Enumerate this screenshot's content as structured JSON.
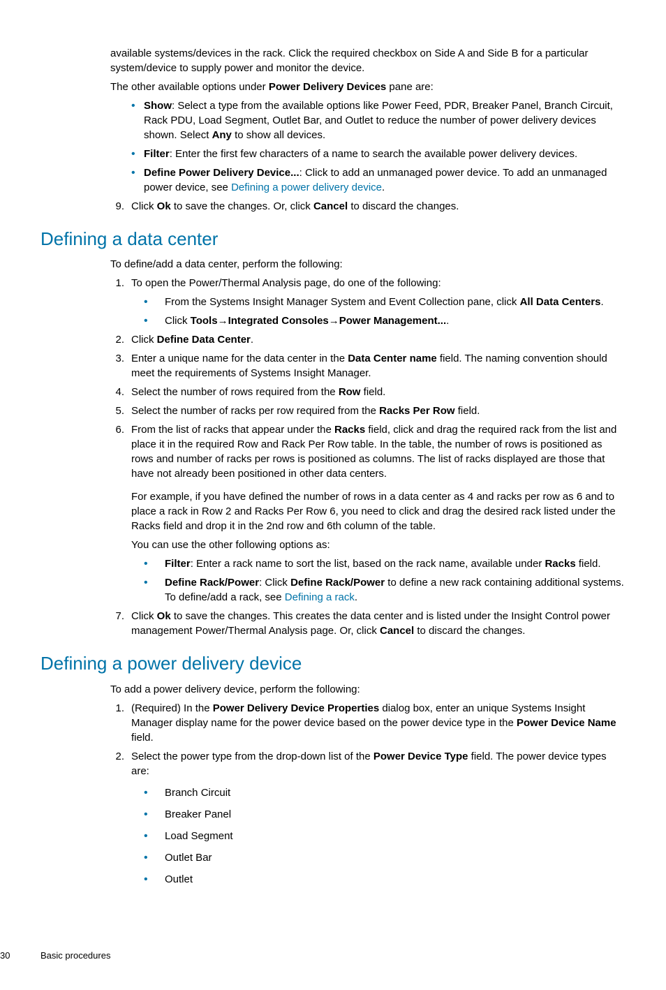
{
  "intro": {
    "p1": "available systems/devices in the rack. Click the required checkbox on Side A and Side B for a particular system/device to supply power and monitor the device.",
    "p2_pre": "The other available options under ",
    "p2_b": "Power Delivery Devices",
    "p2_post": " pane are:",
    "b1_b": "Show",
    "b1_t1": ": Select a type from the available options like Power Feed, PDR, Breaker Panel, Branch Circuit, Rack PDU, Load Segment, Outlet Bar, and Outlet to reduce the number of power delivery devices shown. Select ",
    "b1_b2": "Any",
    "b1_t2": " to show all devices.",
    "b2_b": "Filter",
    "b2_t": ": Enter the first few characters of a name to search the available power delivery devices.",
    "b3_b": "Define Power Delivery Device...",
    "b3_t1": ": Click to add an unmanaged power device. To add an unmanaged power device, see ",
    "b3_link": "Defining a power delivery device",
    "b3_t2": ".",
    "s9_n": "9.",
    "s9_t1": "Click ",
    "s9_b1": "Ok",
    "s9_t2": " to save the changes. Or, click ",
    "s9_b2": "Cancel",
    "s9_t3": " to discard the changes."
  },
  "dc": {
    "title": "Defining a data center",
    "intro": "To define/add a data center, perform the following:",
    "s1_n": "1.",
    "s1_t": "To open the Power/Thermal Analysis page, do one of the following:",
    "s1_b1_t1": "From the Systems Insight Manager System and Event Collection pane, click ",
    "s1_b1_b": "All Data Centers",
    "s1_b1_t2": ".",
    "s1_b2_t1": "Click ",
    "s1_b2_b1": "Tools",
    "s1_b2_arr": "→",
    "s1_b2_b2": "Integrated Consoles",
    "s1_b2_b3": "Power Management...",
    "s1_b2_t2": ".",
    "s2_n": "2.",
    "s2_t1": "Click ",
    "s2_b": "Define Data Center",
    "s2_t2": ".",
    "s3_n": "3.",
    "s3_t1": "Enter a unique name for the data center in the ",
    "s3_b": "Data Center name",
    "s3_t2": " field. The naming convention should meet the requirements of Systems Insight Manager.",
    "s4_n": "4.",
    "s4_t1": "Select the number of rows required from the ",
    "s4_b": "Row",
    "s4_t2": " field.",
    "s5_n": "5.",
    "s5_t1": "Select the number of racks per row required from the ",
    "s5_b": "Racks Per Row",
    "s5_t2": " field.",
    "s6_n": "6.",
    "s6_t1": "From the list of racks that appear under the ",
    "s6_b": "Racks",
    "s6_t2": " field, click and drag the required rack from the list and place it in the required Row and Rack Per Row table. In the table, the number of rows is positioned as rows and number of racks per rows is positioned as columns. The list of racks displayed are those that have not already been positioned in other data centers.",
    "s6_p2": "For example, if you have defined the number of rows in a data center as 4 and racks per row as 6 and to place a rack in Row 2 and Racks Per Row 6, you need to click and drag the desired rack listed under the Racks field and drop it in the 2nd row and 6th column of the table.",
    "s6_p3": "You can use the other following options as:",
    "s6_b1_b": "Filter",
    "s6_b1_t1": ": Enter a rack name to sort the list, based on the rack name, available under ",
    "s6_b1_b2": "Racks",
    "s6_b1_t2": " field.",
    "s6_b2_b": "Define Rack/Power",
    "s6_b2_t1": ": Click ",
    "s6_b2_b2": "Define Rack/Power",
    "s6_b2_t2": " to define a new rack containing additional systems. To define/add a rack, see ",
    "s6_b2_link": "Defining a rack",
    "s6_b2_t3": ".",
    "s7_n": "7.",
    "s7_t1": "Click ",
    "s7_b1": "Ok",
    "s7_t2": " to save the changes. This creates the data center and is listed under the Insight Control power management Power/Thermal Analysis page. Or, click ",
    "s7_b2": "Cancel",
    "s7_t3": " to discard the changes."
  },
  "pdd": {
    "title": "Defining a power delivery device",
    "intro": "To add a power delivery device, perform the following:",
    "s1_n": "1.",
    "s1_t1": "(Required) In the ",
    "s1_b1": "Power Delivery Device Properties",
    "s1_t2": " dialog box, enter an unique Systems Insight Manager display name for the power device based on the power device type in the ",
    "s1_b2": "Power Device Name",
    "s1_t3": " field.",
    "s2_n": "2.",
    "s2_t1": "Select the power type from the drop-down list of the ",
    "s2_b": "Power Device Type",
    "s2_t2": " field. The power device types are:",
    "s2_i1": "Branch Circuit",
    "s2_i2": "Breaker Panel",
    "s2_i3": "Load Segment",
    "s2_i4": "Outlet Bar",
    "s2_i5": "Outlet"
  },
  "footer": {
    "page": "30",
    "section": "Basic procedures"
  }
}
